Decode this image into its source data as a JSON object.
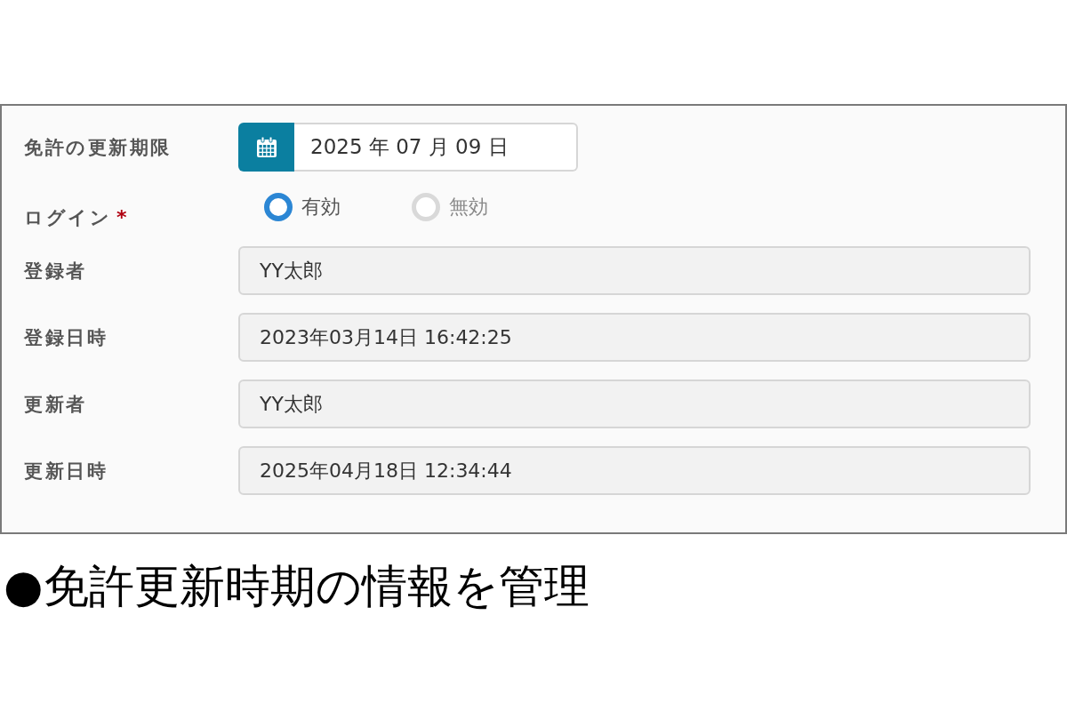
{
  "form": {
    "fields": [
      {
        "kind": "date",
        "label": "免許の更新期限",
        "value": "2025 年 07 月 09 日"
      },
      {
        "kind": "radio",
        "label": "ログイン",
        "required_mark": "*",
        "options": [
          {
            "label": "有効",
            "selected": true
          },
          {
            "label": "無効",
            "selected": false
          }
        ]
      },
      {
        "kind": "text",
        "label": "登録者",
        "value": "YY太郎",
        "readonly": true
      },
      {
        "kind": "text",
        "label": "登録日時",
        "value": "2023年03月14日 16:42:25",
        "readonly": true
      },
      {
        "kind": "text",
        "label": "更新者",
        "value": "YY太郎",
        "readonly": true
      },
      {
        "kind": "text",
        "label": "更新日時",
        "value": "2025年04月18日 12:34:44",
        "readonly": true
      }
    ]
  },
  "caption": "●免許更新時期の情報を管理"
}
